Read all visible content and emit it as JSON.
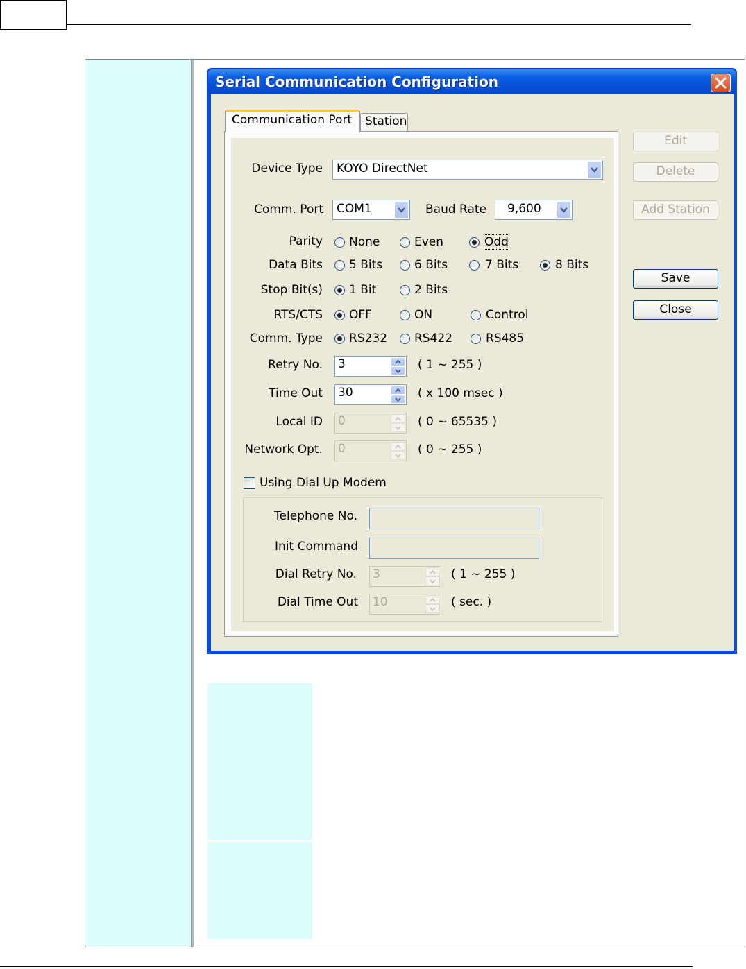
{
  "dialog": {
    "title": "Serial Communication Configuration",
    "tabs": [
      "Communication Port",
      "Station"
    ],
    "active_tab": "Communication Port"
  },
  "buttons": {
    "edit": "Edit",
    "delete": "Delete",
    "add_station": "Add Station",
    "save": "Save",
    "close": "Close"
  },
  "form": {
    "device_type": {
      "label": "Device Type",
      "value": "KOYO DirectNet"
    },
    "comm_port": {
      "label": "Comm. Port",
      "value": "COM1"
    },
    "baud_rate": {
      "label": "Baud Rate",
      "value": "9,600"
    },
    "parity": {
      "label": "Parity",
      "options": [
        "None",
        "Even",
        "Odd"
      ],
      "selected": "Odd"
    },
    "data_bits": {
      "label": "Data Bits",
      "options": [
        "5 Bits",
        "6 Bits",
        "7 Bits",
        "8 Bits"
      ],
      "selected": "8 Bits"
    },
    "stop_bits": {
      "label": "Stop Bit(s)",
      "options": [
        "1 Bit",
        "2 Bits"
      ],
      "selected": "1 Bit"
    },
    "rts_cts": {
      "label": "RTS/CTS",
      "options": [
        "OFF",
        "ON",
        "Control"
      ],
      "selected": "OFF"
    },
    "comm_type": {
      "label": "Comm. Type",
      "options": [
        "RS232",
        "RS422",
        "RS485"
      ],
      "selected": "RS232"
    },
    "retry_no": {
      "label": "Retry No.",
      "value": "3",
      "range": "( 1 ~ 255 )"
    },
    "time_out": {
      "label": "Time Out",
      "value": "30",
      "range": "( x 100 msec )"
    },
    "local_id": {
      "label": "Local ID",
      "value": "0",
      "range": "( 0 ~ 65535 )"
    },
    "network_opt": {
      "label": "Network Opt.",
      "value": "0",
      "range": "( 0 ~ 255 )"
    },
    "dial_up": {
      "label": "Using Dial Up Modem",
      "checked": false
    },
    "telephone_no": {
      "label": "Telephone No.",
      "value": ""
    },
    "init_command": {
      "label": "Init Command",
      "value": ""
    },
    "dial_retry_no": {
      "label": "Dial Retry No.",
      "value": "3",
      "range": "( 1 ~ 255 )"
    },
    "dial_time_out": {
      "label": "Dial Time Out",
      "value": "10",
      "range": "( sec. )"
    }
  },
  "colors": {
    "title_bar": "#0650d6",
    "dialog_face": "#ece9d8",
    "cell_cyan": "#ddfdfd"
  },
  "icons": [
    "close-x-icon",
    "dropdown-arrow-icon",
    "spin-up-icon",
    "spin-down-icon"
  ]
}
